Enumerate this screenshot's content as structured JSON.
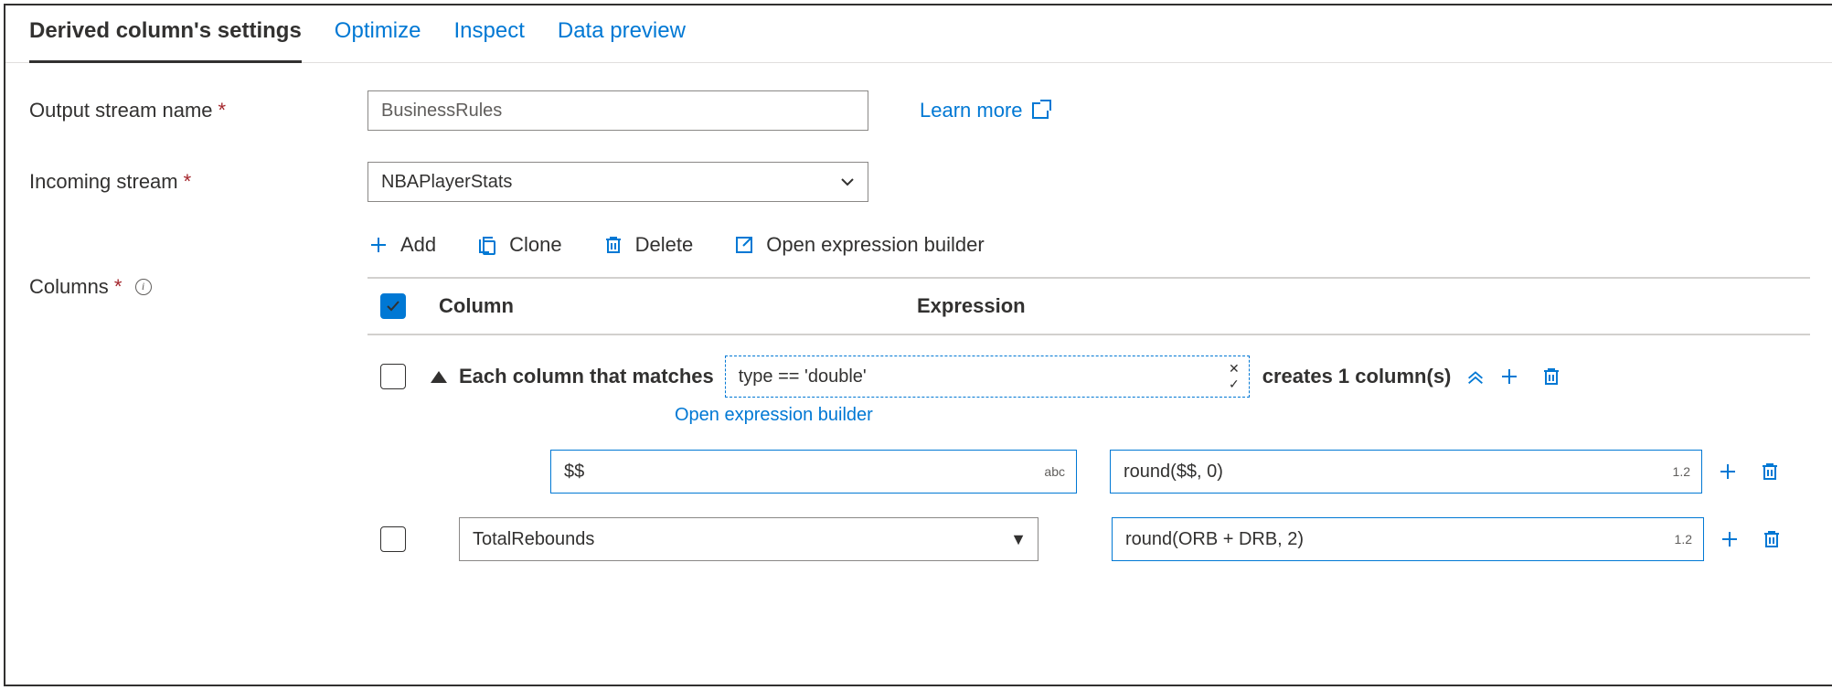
{
  "tabs": {
    "settings": "Derived column's settings",
    "optimize": "Optimize",
    "inspect": "Inspect",
    "preview": "Data preview"
  },
  "fields": {
    "output_label": "Output stream name",
    "output_value": "BusinessRules",
    "incoming_label": "Incoming stream",
    "incoming_value": "NBAPlayerStats",
    "columns_label": "Columns",
    "learn_more": "Learn more"
  },
  "toolbar": {
    "add": "Add",
    "clone": "Clone",
    "delete": "Delete",
    "open_builder": "Open expression builder"
  },
  "grid": {
    "header_column": "Column",
    "header_expression": "Expression",
    "pattern": {
      "prefix": "Each column that matches",
      "condition": "type == 'double'",
      "suffix": "creates 1 column(s)",
      "open_builder": "Open expression builder",
      "sub_col": "$$",
      "sub_col_badge": "abc",
      "sub_expr": "round($$, 0)",
      "sub_expr_badge": "1.2"
    },
    "row2": {
      "col": "TotalRebounds",
      "expr": "round(ORB + DRB, 2)",
      "expr_badge": "1.2"
    }
  }
}
